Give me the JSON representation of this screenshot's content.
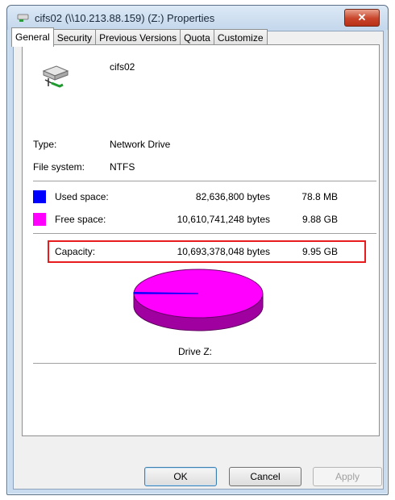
{
  "window": {
    "title": "cifs02 (\\\\10.213.88.159) (Z:) Properties",
    "close_label": "✕"
  },
  "tabs": [
    {
      "label": "General",
      "active": true
    },
    {
      "label": "Security",
      "active": false
    },
    {
      "label": "Previous Versions",
      "active": false
    },
    {
      "label": "Quota",
      "active": false
    },
    {
      "label": "Customize",
      "active": false
    }
  ],
  "general": {
    "drive_name": "cifs02",
    "type_label": "Type:",
    "type_value": "Network Drive",
    "fs_label": "File system:",
    "fs_value": "NTFS",
    "used": {
      "label": "Used space:",
      "bytes": "82,636,800 bytes",
      "size": "78.8 MB",
      "color": "#0000ff"
    },
    "free": {
      "label": "Free space:",
      "bytes": "10,610,741,248 bytes",
      "size": "9.88 GB",
      "color": "#ff00ff"
    },
    "capacity": {
      "label": "Capacity:",
      "bytes": "10,693,378,048 bytes",
      "size": "9.95 GB"
    },
    "drive_caption": "Drive Z:",
    "used_fraction": 0.0077
  },
  "buttons": {
    "ok": "OK",
    "cancel": "Cancel",
    "apply": "Apply"
  },
  "colors": {
    "highlight": "#e81c1c",
    "pie_free_top": "#ff00ff",
    "pie_free_side": "#a000a0",
    "pie_used": "#0000ff"
  }
}
